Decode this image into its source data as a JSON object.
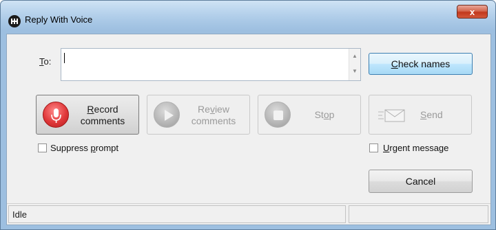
{
  "window": {
    "title": "Reply With Voice",
    "close_glyph": "x"
  },
  "to": {
    "label_accel": "T",
    "label_rest": "o:",
    "value": ""
  },
  "buttons": {
    "check_names_accel": "C",
    "check_names_rest": "heck names",
    "record_line1_accel": "R",
    "record_line1_rest": "ecord",
    "record_line2": "comments",
    "review_line1_pre": "Re",
    "review_line1_accel": "v",
    "review_line1_post": "iew",
    "review_line2": "comments",
    "stop_pre": "St",
    "stop_accel": "o",
    "stop_post": "p",
    "send_accel": "S",
    "send_rest": "end",
    "cancel": "Cancel"
  },
  "options": {
    "suppress_pre": "Suppress ",
    "suppress_accel": "p",
    "suppress_post": "rompt",
    "suppress_checked": false,
    "urgent_accel": "U",
    "urgent_rest": "rgent message",
    "urgent_checked": false
  },
  "status": {
    "text": "Idle",
    "secondary": ""
  },
  "icons": {
    "app": "app-logo-icon",
    "record": "microphone-icon",
    "review": "play-icon",
    "stop": "stop-icon",
    "send": "envelope-icon"
  },
  "colors": {
    "record_red": "#e0383a",
    "check_names_blue": "#bee6fd",
    "titlebar": "#bcd6ee"
  }
}
